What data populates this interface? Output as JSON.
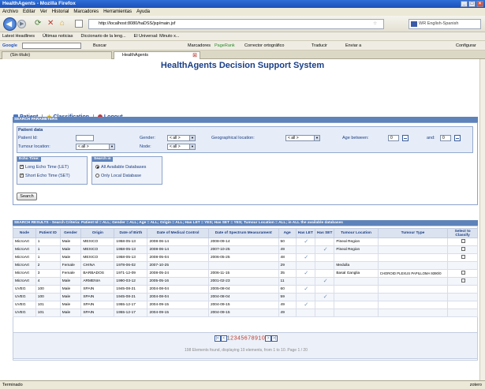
{
  "window": {
    "title": "HealthAgents - Mozilla Firefox"
  },
  "menu": [
    "Archivo",
    "Editar",
    "Ver",
    "Historial",
    "Marcadores",
    "Herramientas",
    "Ayuda"
  ],
  "nav": {
    "url": "http://localhost:8080/haDSS/jsp/main.jsf",
    "search_placeholder": "WR English-Spanish"
  },
  "bookmarks": [
    "Latest Headlines",
    "Últimas noticias",
    "Diccionario de la leng...",
    "El Universal: Minuto x..."
  ],
  "googlebar": {
    "label": "Google",
    "buscar": "Buscar",
    "marcadores": "Marcadores",
    "pagerank": "PageRank",
    "corrector": "Corrector ortográfico",
    "traducir": "Traducir",
    "enviar": "Enviar a",
    "config": "Configurar"
  },
  "tabs": [
    {
      "label": "(Sin título)"
    },
    {
      "label": "HealthAgents"
    }
  ],
  "app": {
    "title": "HealthAgents Decision Support System",
    "links": {
      "patient": "Patient",
      "classification": "Classification",
      "logout": "Logout"
    }
  },
  "search": {
    "header": "SEARCH PARAMETERS",
    "patient_data_label": "Patient data",
    "patient_id_label": "Patient Id:",
    "patient_id_value": "",
    "gender_label": "Gender:",
    "gender_value": "< all >",
    "geo_label": "Geographical location:",
    "geo_value": "< all >",
    "age_between_label": "Age between:",
    "age_from": "0",
    "and_label": "and:",
    "age_to": "0",
    "tumour_location_label": "Tumour location:",
    "tumour_location_value": "< all >",
    "node_label": "Node:",
    "node_value": "< all >",
    "echo_time": {
      "header": "Echo Time:",
      "let": "Long Echo Time (LET)",
      "set": "Short Echo Time (SET)"
    },
    "search_in": {
      "header": "Search in",
      "all": "All Available Databases",
      "local": "Only Local Database"
    },
    "search_button": "Search"
  },
  "results": {
    "header": "SEARCH RESULTS - Search Criteria: Patient Id = ALL; Gender = ALL; Age = ALL; Origin = ALL; Has LET = YES; Has SET = YES; Tumour Location = ALL; in ALL the available databases",
    "columns": [
      "Node",
      "Patient ID",
      "Gender",
      "Origin",
      "Date of Birth",
      "Date of Medical Control",
      "Date of Spectrum Measurament",
      "Age",
      "Has LET",
      "Has SET",
      "Tumour Location",
      "Tumour Type",
      "Select to Classify"
    ],
    "rows": [
      {
        "node": "MicroArt",
        "pid": "1",
        "gender": "Male",
        "origin": "MEXICO",
        "dob": "1958-05-13",
        "dmc": "2008-06-14",
        "dsm": "2008-09-14",
        "age": "50",
        "let": true,
        "set": false,
        "tloc": "Pineal Region",
        "ttype": "",
        "select": true
      },
      {
        "node": "MicroArt",
        "pid": "1",
        "gender": "Male",
        "origin": "MEXICO",
        "dob": "1958-05-13",
        "dmc": "2008-06-14",
        "dsm": "2007-10-25",
        "age": "49",
        "let": false,
        "set": true,
        "tloc": "Pineal Region",
        "ttype": "",
        "select": true
      },
      {
        "node": "MicroArt",
        "pid": "1",
        "gender": "Male",
        "origin": "MEXICO",
        "dob": "1958-05-13",
        "dmc": "2008-05-04",
        "dsm": "2006-05-25",
        "age": "48",
        "let": true,
        "set": false,
        "tloc": "",
        "ttype": "",
        "select": true
      },
      {
        "node": "MicroArt",
        "pid": "2",
        "gender": "Female",
        "origin": "CHINA",
        "dob": "1978-06-02",
        "dmc": "2007-10-25",
        "dsm": "",
        "age": "29",
        "let": false,
        "set": false,
        "tloc": "Medulla",
        "ttype": "",
        "select": false
      },
      {
        "node": "MicroArt",
        "pid": "3",
        "gender": "Female",
        "origin": "BARBADOS",
        "dob": "1971-12-09",
        "dmc": "2008-05-24",
        "dsm": "2006-11-15",
        "age": "35",
        "let": true,
        "set": false,
        "tloc": "Basal Ganglia",
        "ttype": "CHOROID PLEXUS PAPILLOMA 9390/0",
        "select": true
      },
      {
        "node": "MicroArt",
        "pid": "4",
        "gender": "Male",
        "origin": "ARMENIA",
        "dob": "1990-03-12",
        "dmc": "2005-05-16",
        "dsm": "2001-02-23",
        "age": "11",
        "let": false,
        "set": true,
        "tloc": "",
        "ttype": "",
        "select": true
      },
      {
        "node": "UVEG",
        "pid": "100",
        "gender": "Male",
        "origin": "SPAIN",
        "dob": "1945-08-21",
        "dmc": "2004-08-04",
        "dsm": "2005-08-04",
        "age": "60",
        "let": true,
        "set": false,
        "tloc": "",
        "ttype": "",
        "select": false
      },
      {
        "node": "UVEG",
        "pid": "100",
        "gender": "Male",
        "origin": "SPAIN",
        "dob": "1945-08-21",
        "dmc": "2004-08-04",
        "dsm": "2004-08-04",
        "age": "59",
        "let": false,
        "set": true,
        "tloc": "",
        "ttype": "",
        "select": false
      },
      {
        "node": "UVEG",
        "pid": "101",
        "gender": "Male",
        "origin": "SPAIN",
        "dob": "1955-12-17",
        "dmc": "2004-09-15",
        "dsm": "2004-09-15",
        "age": "49",
        "let": true,
        "set": false,
        "tloc": "",
        "ttype": "",
        "select": false
      },
      {
        "node": "UVEG",
        "pid": "101",
        "gender": "Male",
        "origin": "SPAIN",
        "dob": "1955-12-17",
        "dmc": "2004-09-15",
        "dsm": "2004-09-15",
        "age": "49",
        "let": false,
        "set": false,
        "tloc": "",
        "ttype": "",
        "select": false
      }
    ],
    "pages": [
      "1",
      "2",
      "3",
      "4",
      "5",
      "6",
      "7",
      "8",
      "9",
      "10"
    ],
    "current_page": "1",
    "info": "198 Elements found, displaying 10 elements, from 1 to 10. Page 1 / 20"
  },
  "status": {
    "left": "Terminado",
    "right": "zotero"
  },
  "colors": {
    "section_header": "#5e83bb",
    "link": "#1f4a9a",
    "page_link": "#c0392b",
    "check": "#6a8bb8"
  }
}
